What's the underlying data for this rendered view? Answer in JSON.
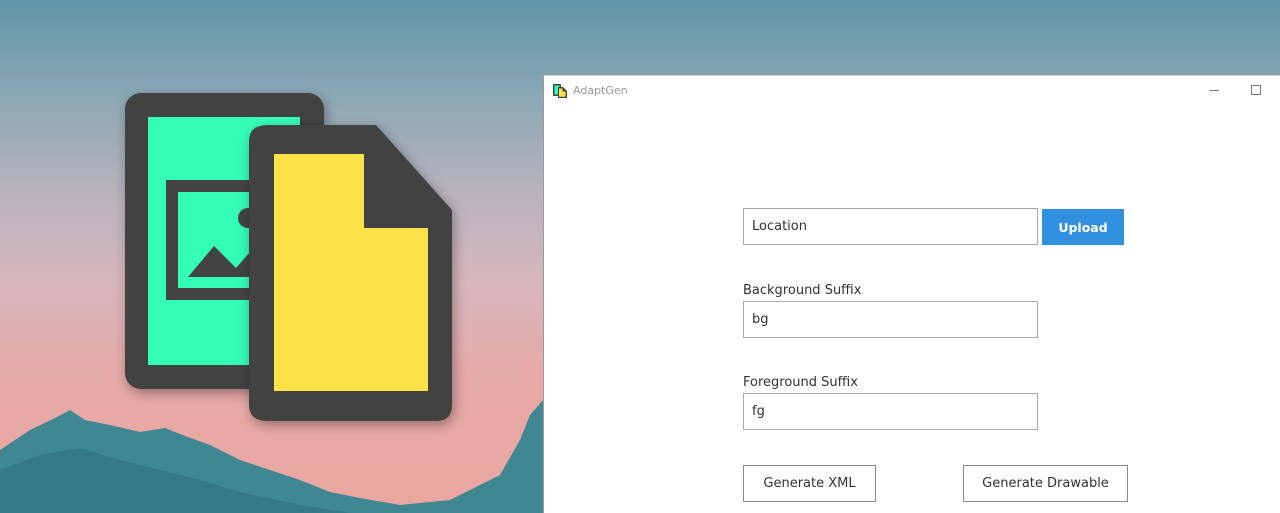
{
  "window": {
    "title": "AdaptGen",
    "controls": {
      "minimize": "minimize",
      "maximize": "maximize"
    }
  },
  "form": {
    "location": {
      "placeholder": "Location",
      "value": ""
    },
    "upload_label": "Upload",
    "background_suffix": {
      "label": "Background Suffix",
      "value": "bg"
    },
    "foreground_suffix": {
      "label": "Foreground Suffix",
      "value": "fg"
    },
    "generate_xml_label": "Generate XML",
    "generate_drawable_label": "Generate Drawable"
  },
  "colors": {
    "accent": "#3290e0",
    "logo_green": "#34fdb8",
    "logo_yellow": "#ffe14a",
    "logo_frame": "#434343",
    "mountains": "#3f8793"
  },
  "icons": {
    "app": "adaptgen-app-icon",
    "logo": "image-and-file-icon"
  }
}
